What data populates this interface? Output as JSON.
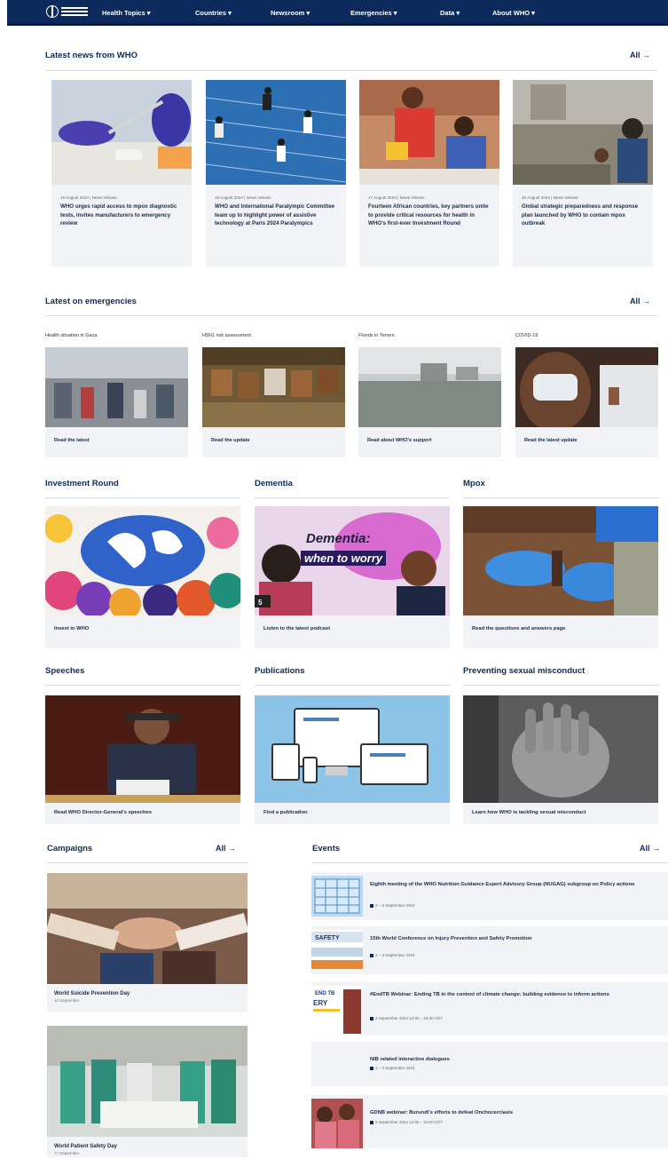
{
  "nav": {
    "items": [
      "Health Topics ▾",
      "Countries ▾",
      "Newsroom ▾",
      "Emergencies ▾",
      "Data ▾",
      "About WHO ▾"
    ]
  },
  "news": {
    "title": "Latest news from WHO",
    "all": "All →",
    "items": [
      {
        "meta": "19 August 2024 | News release",
        "title": "WHO urges rapid access to mpox diagnostic tests, invites manufacturers to emergency review"
      },
      {
        "meta": "19 August 2024 | News release",
        "title": "WHO and International Paralympic Committee team up to highlight power of assistive technology at Paris 2024 Paralympics"
      },
      {
        "meta": "17 August 2024 | News release",
        "title": "Fourteen African countries, key partners unite to provide critical resources for health in WHO's first-ever Investment Round"
      },
      {
        "meta": "26 August 2024 | News release",
        "title": "Global strategic preparedness and response plan launched by WHO to contain mpox outbreak"
      }
    ]
  },
  "emergencies": {
    "title": "Latest on emergencies",
    "all": "All →",
    "items": [
      {
        "label": "Health situation in Gaza",
        "link": "Read the latest"
      },
      {
        "label": "H5N1 risk assessment",
        "link": "Read the update"
      },
      {
        "label": "Floods in Yemen",
        "link": "Read about WHO's support"
      },
      {
        "label": "COVID-19",
        "link": "Read the latest update"
      }
    ]
  },
  "features": [
    {
      "title": "Investment Round",
      "link": "Invest in WHO"
    },
    {
      "title": "Dementia",
      "link": "Listen to the latest podcast",
      "overlay1": "Dementia:",
      "overlay2": "when to worry"
    },
    {
      "title": "Mpox",
      "link": "Read the questions and answers page"
    },
    {
      "title": "Speeches",
      "link": "Read WHO Director-General's speeches"
    },
    {
      "title": "Publications",
      "link": "Find a publication"
    },
    {
      "title": "Preventing sexual misconduct",
      "link": "Learn how WHO is tackling sexual misconduct"
    }
  ],
  "campaigns": {
    "title": "Campaigns",
    "all": "All →",
    "items": [
      {
        "title": "World Suicide Prevention Day",
        "sub": "10 September"
      },
      {
        "title": "World Patient Safety Day",
        "sub": "17 September"
      }
    ]
  },
  "events": {
    "title": "Events",
    "all": "All →",
    "items": [
      {
        "title": "Eighth meeting of the WHO Nutrition Guidance Expert Advisory Group (NUGAG) subgroup on Policy actions",
        "date": "2 – 3 September 2024"
      },
      {
        "title": "15th World Conference on Injury Prevention and Safety Promotion",
        "date": "2 – 4 September 2024"
      },
      {
        "title": "#EndTB Webinar: Ending TB in the context of climate change: building evidence to inform actions",
        "date": "3 September 2024 14:00 – 15:30 CET"
      },
      {
        "title": "NIB related interactive dialogues",
        "date": "3 – 4 September 2024"
      },
      {
        "title": "GDNB webinar: Burundi's efforts to defeat Onchocerciasis",
        "date": "5 September 2024 13:00 – 15:00 CET"
      }
    ]
  },
  "colors": {
    "brand": "#0d2a5c",
    "card_bg": "#f1f3f6",
    "rule": "#d9dde3"
  }
}
